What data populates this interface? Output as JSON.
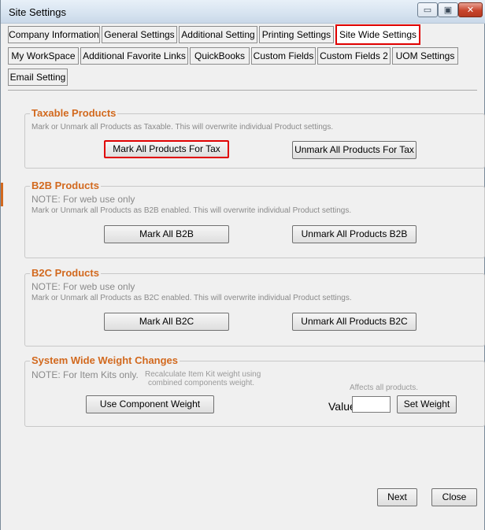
{
  "window": {
    "title": "Site Settings"
  },
  "window_controls": {
    "minimize": "▭",
    "maximize": "▣",
    "close": "✕"
  },
  "tabs": {
    "row1": [
      "Company Information",
      "General Settings",
      "Additional Setting",
      "Printing Settings",
      "Site Wide Settings"
    ],
    "row2": [
      "My WorkSpace",
      "Additional Favorite Links",
      "QuickBooks",
      "Custom Fields",
      "Custom Fields 2",
      "UOM Settings"
    ],
    "row3": [
      "Email Setting"
    ],
    "active": "Site Wide Settings"
  },
  "taxable": {
    "legend": "Taxable Products",
    "desc": "Mark or Unmark all Products as Taxable. This will overwrite individual Product settings.",
    "mark_label": "Mark All Products For Tax",
    "unmark_label": "Unmark All Products For Tax"
  },
  "b2b": {
    "legend": "B2B Products",
    "note": "NOTE: For web use only",
    "desc": "Mark or Unmark all Products as B2B enabled. This will overwrite individual Product settings.",
    "mark_label": "Mark All B2B",
    "unmark_label": "Unmark All Products B2B"
  },
  "b2c": {
    "legend": "B2C Products",
    "note": "NOTE: For web use only",
    "desc": "Mark or Unmark all Products as B2C enabled. This will overwrite individual Product settings.",
    "mark_label": "Mark All B2C",
    "unmark_label": "Unmark All Products B2C"
  },
  "weight": {
    "legend": "System Wide Weight Changes",
    "note": "NOTE: For Item Kits only.",
    "desc_line1": "Recalculate Item Kit weight using",
    "desc_line2": "combined components weight.",
    "affects": "Affects all products.",
    "use_component_label": "Use Component Weight",
    "value_label": "Value",
    "value": "",
    "set_weight_label": "Set Weight"
  },
  "footer": {
    "next_label": "Next",
    "close_label": "Close"
  }
}
